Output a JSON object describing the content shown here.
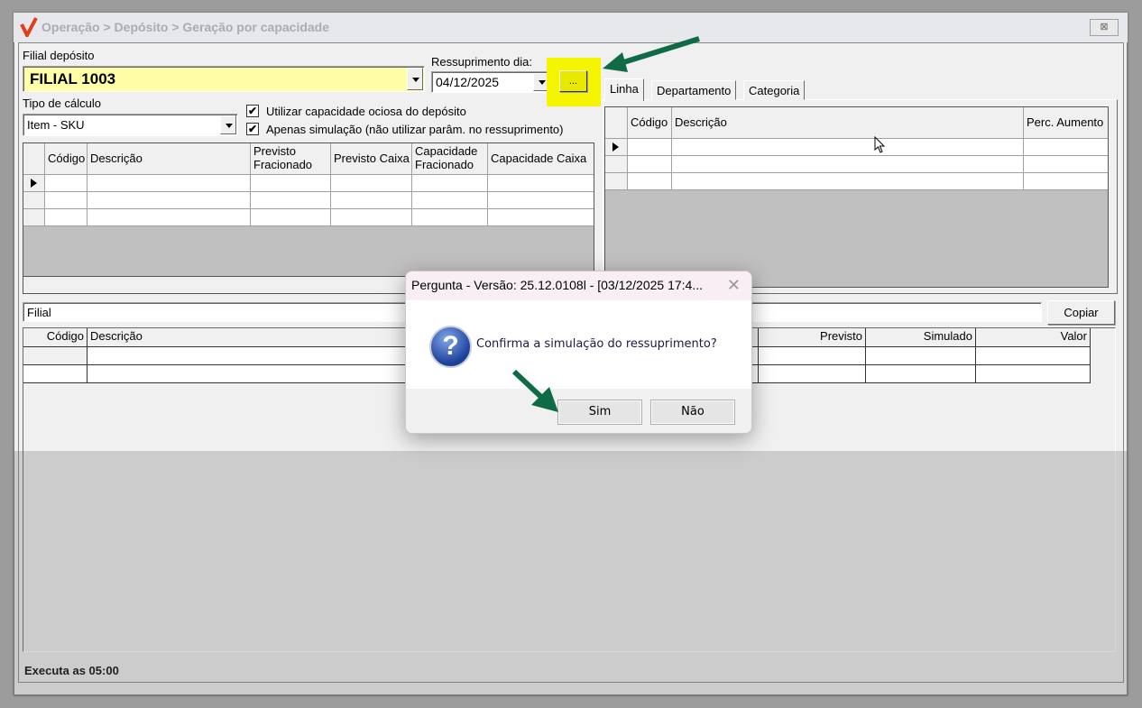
{
  "window": {
    "title": "Operação > Depósito > Geração por capacidade",
    "close_label": "⊠"
  },
  "form": {
    "filial_label": "Filial depósito",
    "filial_value": "FILIAL 1003",
    "ressup_label": "Ressuprimento dia:",
    "ressup_value": "04/12/2025",
    "ellipsis_label": "...",
    "tipo_label": "Tipo de cálculo",
    "tipo_value": "Item - SKU",
    "chk1_label": "Utilizar capacidade ociosa do depósito",
    "chk2_label": "Apenas simulação (não utilizar parâm. no ressuprimento)",
    "chk_mark": "✔"
  },
  "grid1": {
    "headers": [
      "Código",
      "Descrição",
      "Previsto Fracionado",
      "Previsto Caixa",
      "Capacidade Fracionado",
      "Capacidade Caixa"
    ]
  },
  "tabs": [
    "Linha",
    "Departamento",
    "Categoria"
  ],
  "grid2": {
    "headers": [
      "Código",
      "Descrição",
      "Perc. Aumento"
    ]
  },
  "filial_field": "Filial",
  "copiar_label": "Copiar",
  "grid3": {
    "headers": [
      "Código",
      "Descrição",
      "Previsto",
      "Simulado",
      "Valor"
    ]
  },
  "status": "Executa as 05:00",
  "dialog": {
    "title": "Pergunta - Versão: 25.12.0108l - [03/12/2025 17:4...",
    "close": "✕",
    "message": "Confirma a simulação do ressuprimento?",
    "icon": "?",
    "yes": "Sim",
    "no": "Não"
  },
  "colors": {
    "highlight": "#f5f500",
    "arrow": "#0f6b45",
    "filial_bg": "#ffffa8"
  }
}
